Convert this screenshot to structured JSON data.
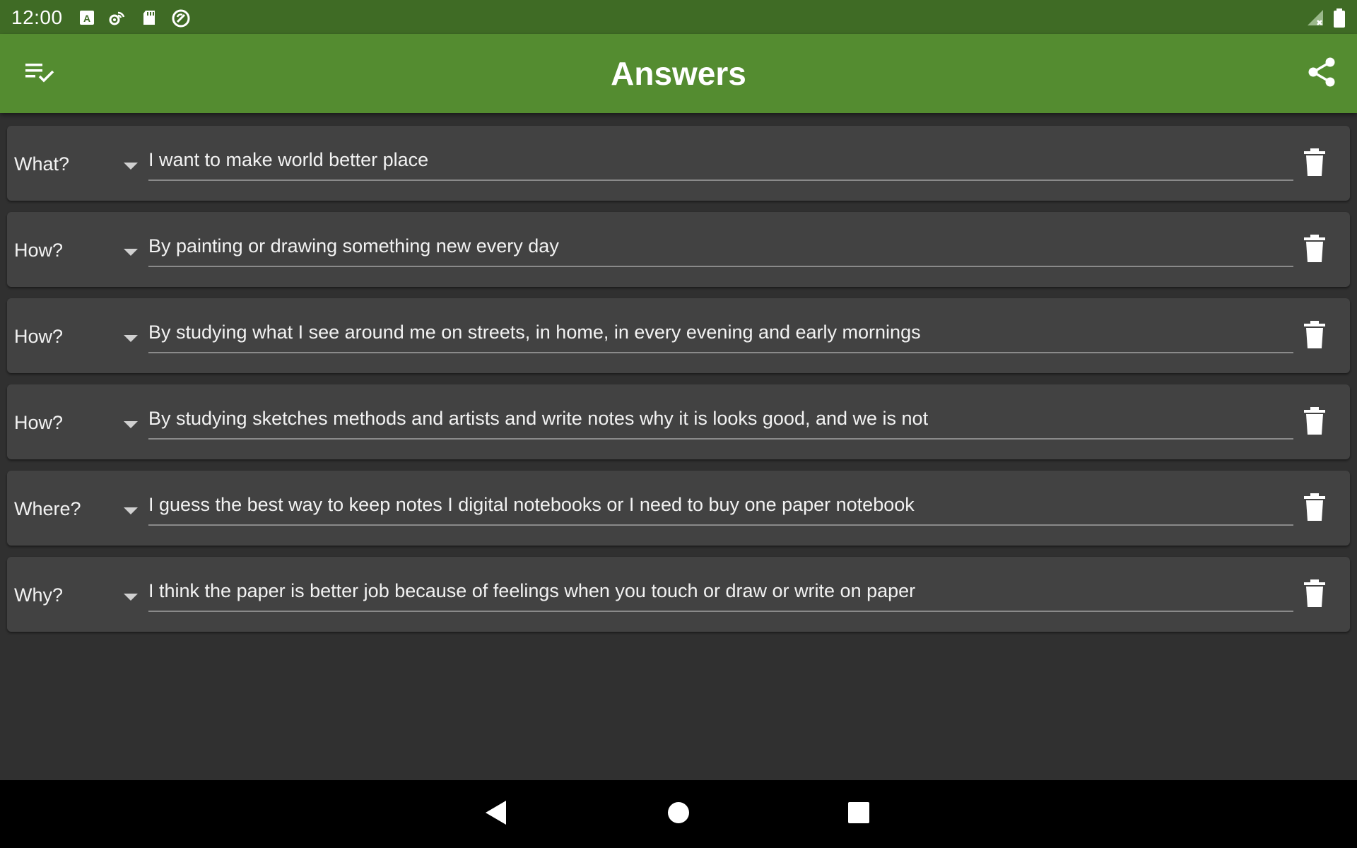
{
  "status_bar": {
    "time": "12:00",
    "icons": [
      "keyboard-icon",
      "settings-wifi-icon",
      "sd-card-icon",
      "sync-icon",
      "signal-icon",
      "battery-icon"
    ]
  },
  "app_bar": {
    "title": "Answers",
    "left_icon": "checklist-icon",
    "right_icon": "share-icon"
  },
  "answers": [
    {
      "type": "What?",
      "text": "I want to make world better place"
    },
    {
      "type": "How?",
      "text": "By painting or drawing something new every day"
    },
    {
      "type": "How?",
      "text": "By studying what I see around me on streets, in home, in every evening and early mornings"
    },
    {
      "type": "How?",
      "text": "By studying sketches methods and artists and write notes why it is looks good, and we is not"
    },
    {
      "type": "Where?",
      "text": "I guess the best way to keep notes I digital notebooks or  I need to buy one paper notebook"
    },
    {
      "type": "Why?",
      "text": "I think the paper is better job because of feelings when you  touch or draw or write on paper"
    }
  ],
  "colors": {
    "status_bar": "#3f6b25",
    "app_bar": "#548c30",
    "background": "#303030",
    "card": "#424242",
    "nav_bar": "#000000"
  },
  "nav_bar": {
    "icons": [
      "back-icon",
      "home-icon",
      "recents-icon"
    ]
  }
}
